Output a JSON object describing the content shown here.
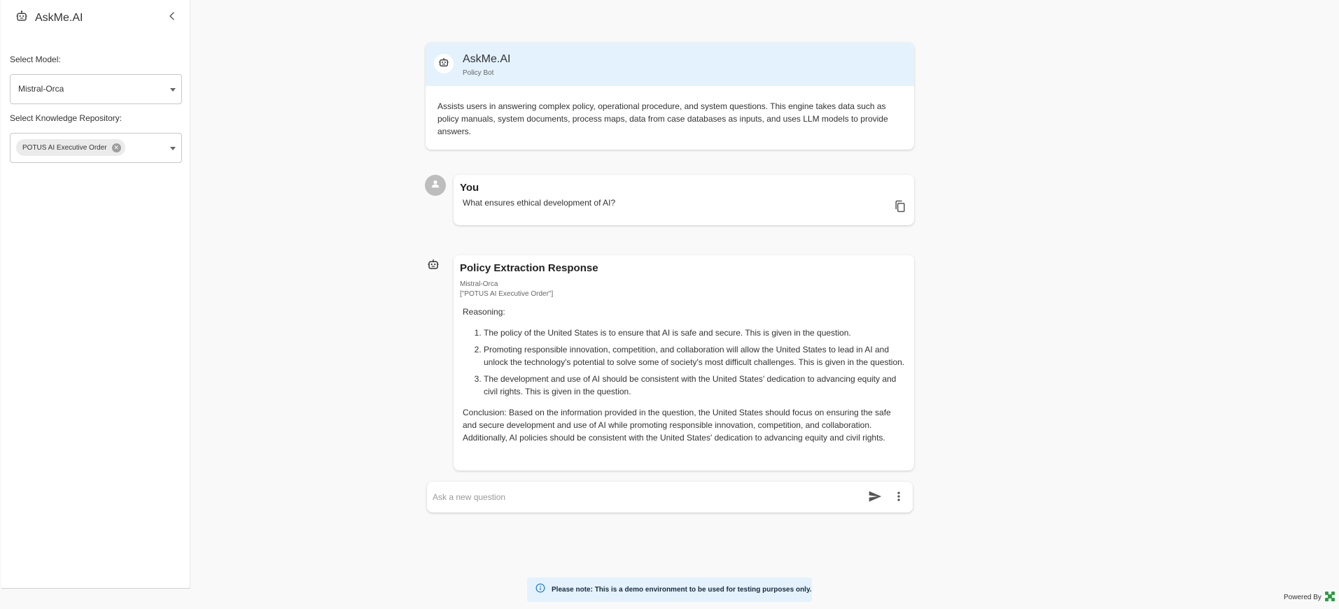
{
  "app": {
    "title": "AskMe.AI"
  },
  "sidebar": {
    "model_label": "Select Model:",
    "model_value": "Mistral-Orca",
    "repo_label": "Select Knowledge Repository:",
    "repo_chip": "POTUS AI Executive Order"
  },
  "bot_info": {
    "name": "AskMe.AI",
    "subtitle": "Policy Bot",
    "description": "Assists users in answering complex policy, operational procedure, and system questions. This engine takes data such as policy manuals, system documents, process maps, data from case databases as inputs, and uses LLM models to provide answers."
  },
  "user_message": {
    "author": "You",
    "text": "What ensures ethical development of AI?"
  },
  "response": {
    "title": "Policy Extraction Response",
    "model": "Mistral-Orca",
    "repos": "[\"POTUS AI Executive Order\"]",
    "reasoning_label": "Reasoning:",
    "items": [
      "The policy of the United States is to ensure that AI is safe and secure. This is given in the question.",
      "Promoting responsible innovation, competition, and collaboration will allow the United States to lead in AI and unlock the technology's potential to solve some of society's most difficult challenges. This is given in the question.",
      "The development and use of AI should be consistent with the United States' dedication to advancing equity and civil rights. This is given in the question."
    ],
    "conclusion": "Conclusion: Based on the information provided in the question, the United States should focus on ensuring the safe and secure development and use of AI while promoting responsible innovation, competition, and collaboration. Additionally, AI policies should be consistent with the United States' dedication to advancing equity and civil rights."
  },
  "ask": {
    "placeholder": "Ask a new question"
  },
  "notice": {
    "text": "Please note: This is a demo environment to be used for testing purposes only."
  },
  "footer": {
    "powered_by": "Powered By"
  },
  "colors": {
    "accent_light": "#e3f2fd",
    "logo_green": "#2e9e44"
  }
}
